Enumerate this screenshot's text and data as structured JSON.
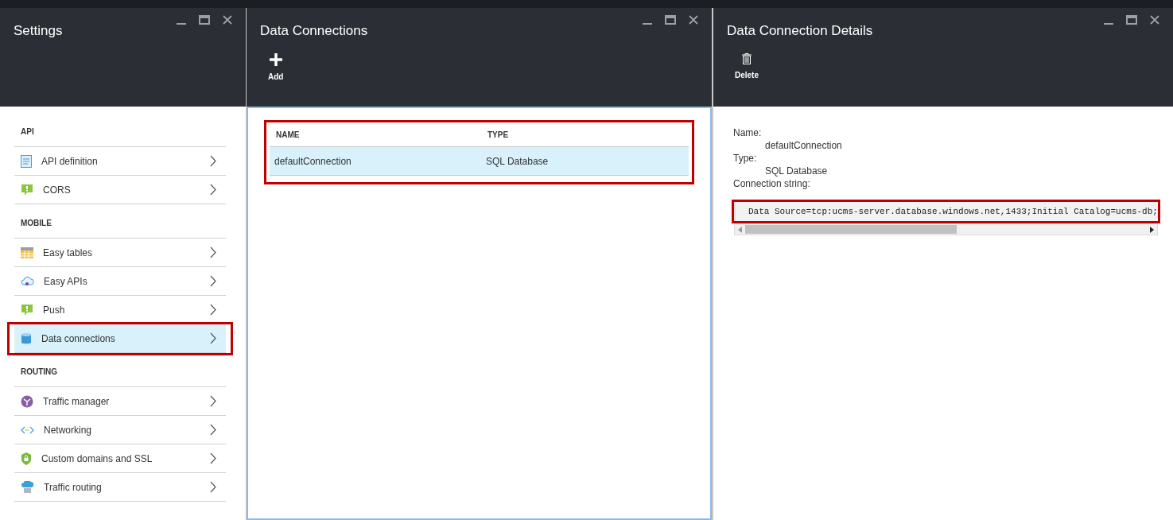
{
  "blades": [
    {
      "kind": "settings",
      "title": "Settings",
      "sections": [
        {
          "heading": "API",
          "items": [
            {
              "label": "API definition",
              "selected": false,
              "highlighted": false
            },
            {
              "label": "CORS",
              "selected": false,
              "highlighted": false
            }
          ]
        },
        {
          "heading": "MOBILE",
          "items": [
            {
              "label": "Easy tables",
              "selected": false,
              "highlighted": false
            },
            {
              "label": "Easy APIs",
              "selected": false,
              "highlighted": false
            },
            {
              "label": "Push",
              "selected": false,
              "highlighted": false
            },
            {
              "label": "Data connections",
              "selected": true,
              "highlighted": true
            }
          ]
        },
        {
          "heading": "ROUTING",
          "items": [
            {
              "label": "Traffic manager",
              "selected": false,
              "highlighted": false
            },
            {
              "label": "Networking",
              "selected": false,
              "highlighted": false
            },
            {
              "label": "Custom domains and SSL",
              "selected": false,
              "highlighted": false
            },
            {
              "label": "Traffic routing",
              "selected": false,
              "highlighted": false
            }
          ]
        }
      ]
    },
    {
      "kind": "list",
      "title": "Data Connections",
      "command": "Add",
      "table": {
        "highlighted": true,
        "columns": [
          "NAME",
          "TYPE"
        ],
        "rows": [
          {
            "cells": [
              "defaultConnection",
              "SQL Database"
            ],
            "selected": true
          }
        ]
      }
    },
    {
      "kind": "details",
      "title": "Data Connection Details",
      "command": "Delete",
      "fields": [
        {
          "label": "Name:",
          "value": "defaultConnection"
        },
        {
          "label": "Type:",
          "value": "SQL Database"
        }
      ],
      "connection_label": "Connection string:",
      "connection_string": {
        "value": "Data Source=tcp:ucms-server.database.windows.net,1433;Initial Catalog=ucms-db;",
        "highlighted": true
      }
    }
  ]
}
